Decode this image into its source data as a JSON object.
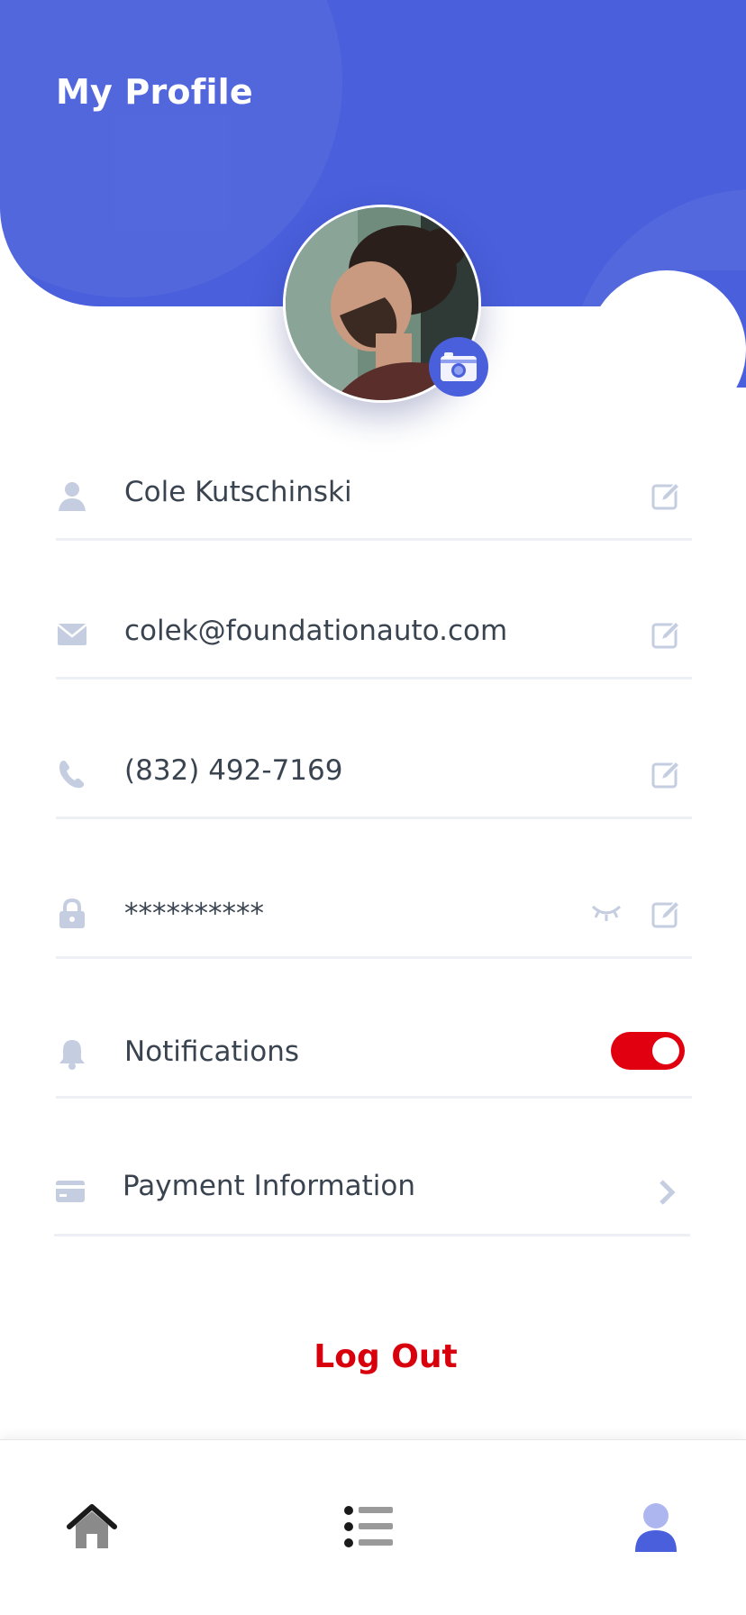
{
  "header": {
    "title": "My Profile",
    "accent_color": "#4a5fdc"
  },
  "profile": {
    "avatar_icon": "avatar-photo",
    "camera_icon": "camera-icon"
  },
  "fields": {
    "name": {
      "value": "Cole Kutschinski",
      "icon": "user-icon"
    },
    "email": {
      "value": "colek@foundationauto.com",
      "icon": "envelope-icon"
    },
    "phone": {
      "value": "(832) 492-7169",
      "icon": "phone-icon"
    },
    "password": {
      "value": "**********",
      "icon": "lock-icon"
    },
    "notifications": {
      "label": "Notifications",
      "enabled": true,
      "icon": "bell-icon",
      "toggle_color": "#e0000f"
    },
    "payment": {
      "label": "Payment Information",
      "icon": "credit-card-icon"
    }
  },
  "logout": {
    "label": "Log Out",
    "color": "#d8000c"
  },
  "tabbar": {
    "tabs": [
      {
        "icon": "home-icon",
        "active": false
      },
      {
        "icon": "list-icon",
        "active": false
      },
      {
        "icon": "profile-icon",
        "active": true
      }
    ]
  }
}
